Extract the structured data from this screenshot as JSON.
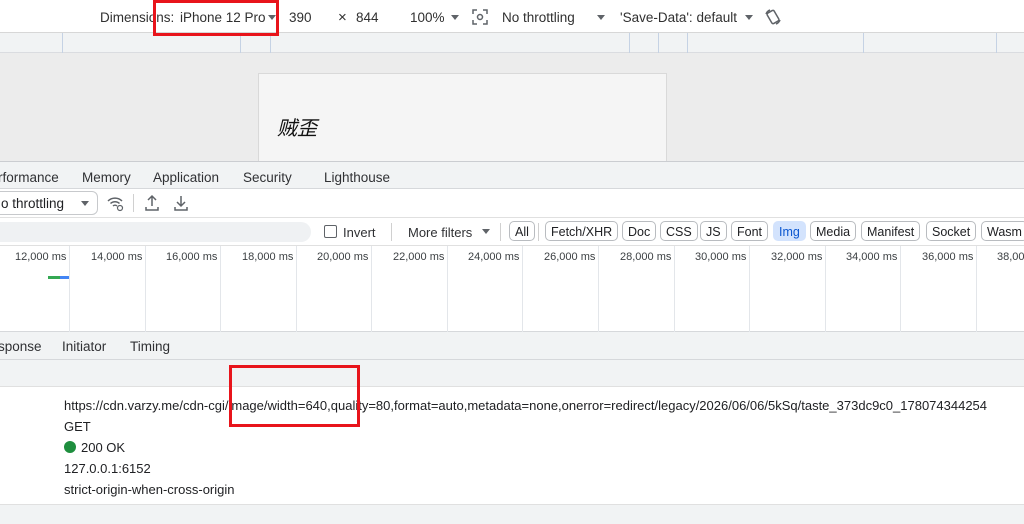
{
  "device_toolbar": {
    "dimensions_label": "Dimensions:",
    "device": "iPhone 12 Pro",
    "width": "390",
    "times": "×",
    "height": "844",
    "zoom": "100%",
    "throttling": "No throttling",
    "save_data": "'Save-Data': default"
  },
  "page": {
    "text": "贼歪"
  },
  "devtools_tabs": [
    "rformance",
    "Memory",
    "Application",
    "Security",
    "Lighthouse"
  ],
  "network_toolbar": {
    "throttling": "o throttling"
  },
  "filter_bar": {
    "invert_label": "Invert",
    "more_filters_label": "More filters",
    "chips": [
      "All",
      "Fetch/XHR",
      "Doc",
      "CSS",
      "JS",
      "Font",
      "Img",
      "Media",
      "Manifest",
      "Socket",
      "Wasm"
    ],
    "active_chip": "Img"
  },
  "timeline": {
    "labels": [
      "12,000 ms",
      "14,000 ms",
      "16,000 ms",
      "18,000 ms",
      "20,000 ms",
      "22,000 ms",
      "24,000 ms",
      "26,000 ms",
      "28,000 ms",
      "30,000 ms",
      "32,000 ms",
      "34,000 ms",
      "36,000 ms",
      "38,00"
    ]
  },
  "detail_tabs": [
    "sponse",
    "Initiator",
    "Timing"
  ],
  "request": {
    "url": "https://cdn.varzy.me/cdn-cgi/image/width=640,quality=80,format=auto,metadata=none,onerror=redirect/legacy/2026/06/06/5kSq/taste_373dc9c0_178074344254",
    "method": "GET",
    "status": "200 OK",
    "remote_address": "127.0.0.1:6152",
    "referrer_policy": "strict-origin-when-cross-origin"
  },
  "colors": {
    "highlight": "#e8141b",
    "status_ok": "#1e8e3e",
    "active_chip_bg": "#d3e3fd"
  }
}
